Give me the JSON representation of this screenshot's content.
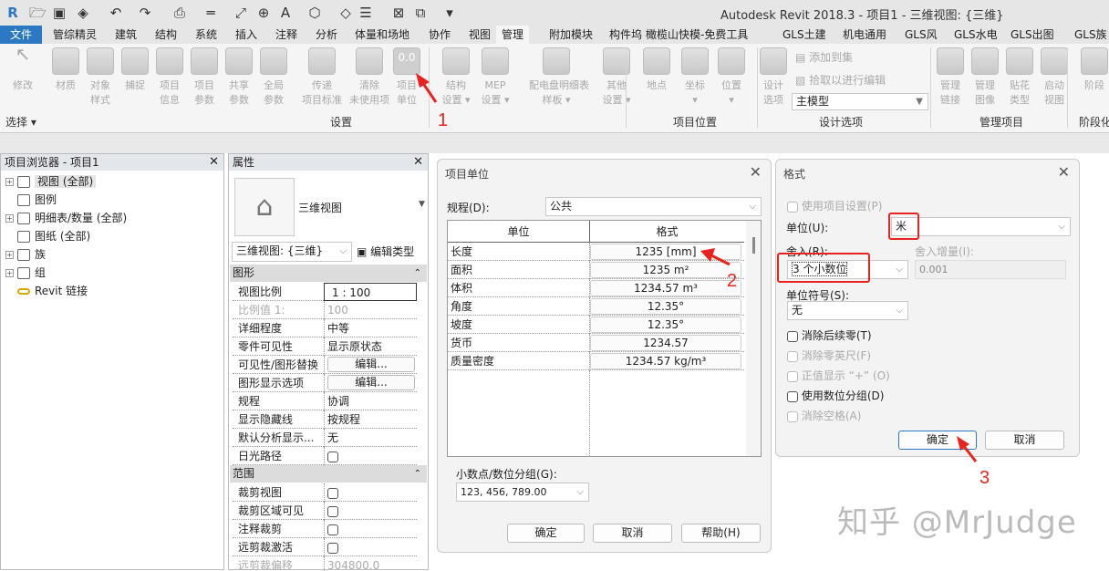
{
  "colors": {
    "accent": "#2b79c2",
    "annotation": "#e8231f",
    "watermark": "#bbbbbb"
  },
  "quick_access": [
    "revit-logo",
    "open-icon",
    "save-icon",
    "sync-icon",
    "undo-icon",
    "redo-icon",
    "print-icon",
    "measure-icon",
    "dimension-icon",
    "tag-icon",
    "text-icon",
    "3d-view-icon",
    "section-icon",
    "thin-lines-icon",
    "close-hidden-icon",
    "switch-windows-icon",
    "customize-icon"
  ],
  "app_title": "Autodesk Revit 2018.3 -     项目1 - 三维视图: {三维}",
  "tabs": [
    {
      "label": "文件"
    },
    {
      "label": "管综精灵"
    },
    {
      "label": "建筑"
    },
    {
      "label": "结构"
    },
    {
      "label": "系统"
    },
    {
      "label": "插入"
    },
    {
      "label": "注释"
    },
    {
      "label": "分析"
    },
    {
      "label": "体量和场地"
    },
    {
      "label": "协作"
    },
    {
      "label": "视图"
    },
    {
      "label": "管理"
    },
    {
      "label": "附加模块"
    },
    {
      "label": "构件坞"
    },
    {
      "label": "橄榄山快模-免费工具"
    },
    {
      "label": "GLS土建"
    },
    {
      "label": "机电通用"
    },
    {
      "label": "GLS风"
    },
    {
      "label": "GLS水电"
    },
    {
      "label": "GLS出图"
    },
    {
      "label": "GLS族"
    }
  ],
  "active_tab": "管理",
  "ribbon": {
    "buttons": [
      {
        "label": "修改",
        "icon": "cursor-icon"
      },
      {
        "label": "材质",
        "icon": "material-sphere-icon"
      },
      {
        "label": "对象\n样式",
        "icon": "object-styles-icon"
      },
      {
        "label": "捕捉",
        "icon": "snap-magnet-icon"
      },
      {
        "label": "项目\n信息",
        "icon": "project-info-icon"
      },
      {
        "label": "项目\n参数",
        "icon": "project-params-icon"
      },
      {
        "label": "共享\n参数",
        "icon": "shared-params-icon"
      },
      {
        "label": "全局\n参数",
        "icon": "global-params-icon"
      },
      {
        "label": "传递\n项目标准",
        "icon": "transfer-standards-icon"
      },
      {
        "label": "清除\n未使用项",
        "icon": "purge-icon"
      },
      {
        "label": "项目\n单位",
        "icon": "project-units-icon"
      },
      {
        "label": "结构\n设置 ▾",
        "icon": "structural-settings-icon"
      },
      {
        "label": "MEP\n设置 ▾",
        "icon": "mep-settings-icon"
      },
      {
        "label": "配电盘明细表\n样板 ▾",
        "icon": "panel-schedule-icon"
      },
      {
        "label": "其他\n设置 ▾",
        "icon": "wrench-icon"
      },
      {
        "label": "地点",
        "icon": "location-globe-icon"
      },
      {
        "label": "坐标\n▾",
        "icon": "coordinates-icon"
      },
      {
        "label": "位置\n▾",
        "icon": "position-icon"
      },
      {
        "label": "设计\n选项",
        "icon": "design-options-icon"
      },
      {
        "label": "管理\n链接",
        "icon": "manage-links-icon"
      },
      {
        "label": "管理\n图像",
        "icon": "manage-images-icon"
      },
      {
        "label": "贴花\n类型",
        "icon": "decal-types-icon"
      },
      {
        "label": "启动\n视图",
        "icon": "starting-view-icon"
      },
      {
        "label": "阶段",
        "icon": "phases-icon"
      }
    ],
    "add_to_set": "添加到集",
    "pick_to_edit": "拾取以进行编辑",
    "design_option_select": "主模型",
    "panels": [
      "选择 ▾",
      "设置",
      "项目位置",
      "设计选项",
      "管理项目",
      "阶段化"
    ]
  },
  "project_browser": {
    "title": "项目浏览器 - 项目1",
    "items": [
      {
        "label": "视图 (全部)",
        "expandable": true,
        "icon": "views-icon"
      },
      {
        "label": "图例",
        "expandable": false,
        "icon": "legend-icon"
      },
      {
        "label": "明细表/数量 (全部)",
        "expandable": true,
        "icon": "schedule-icon"
      },
      {
        "label": "图纸 (全部)",
        "expandable": false,
        "icon": "sheet-icon"
      },
      {
        "label": "族",
        "expandable": true,
        "icon": "family-icon"
      },
      {
        "label": "组",
        "expandable": true,
        "icon": "group-icon"
      },
      {
        "label": "Revit 链接",
        "expandable": false,
        "icon": "link-icon"
      }
    ]
  },
  "properties": {
    "title": "属性",
    "type_name": "三维视图",
    "instance_select": "三维视图: {三维}",
    "edit_type": "编辑类型",
    "sections": [
      {
        "name": "图形",
        "rows": [
          {
            "label": "视图比例",
            "value": "1 : 100",
            "kind": "input"
          },
          {
            "label": "比例值 1:",
            "value": "100",
            "kind": "disabled"
          },
          {
            "label": "详细程度",
            "value": "中等",
            "kind": "text"
          },
          {
            "label": "零件可见性",
            "value": "显示原状态",
            "kind": "text"
          },
          {
            "label": "可见性/图形替换",
            "value": "编辑...",
            "kind": "button"
          },
          {
            "label": "图形显示选项",
            "value": "编辑...",
            "kind": "button"
          },
          {
            "label": "规程",
            "value": "协调",
            "kind": "text"
          },
          {
            "label": "显示隐藏线",
            "value": "按规程",
            "kind": "text"
          },
          {
            "label": "默认分析显示...",
            "value": "无",
            "kind": "text"
          },
          {
            "label": "日光路径",
            "value": "",
            "kind": "checkbox"
          }
        ]
      },
      {
        "name": "范围",
        "rows": [
          {
            "label": "裁剪视图",
            "value": "",
            "kind": "checkbox"
          },
          {
            "label": "裁剪区域可见",
            "value": "",
            "kind": "checkbox"
          },
          {
            "label": "注释裁剪",
            "value": "",
            "kind": "checkbox"
          },
          {
            "label": "远剪裁激活",
            "value": "",
            "kind": "checkbox"
          },
          {
            "label": "远剪裁偏移",
            "value": "304800.0",
            "kind": "disabled"
          }
        ]
      }
    ]
  },
  "project_units": {
    "title": "项目单位",
    "discipline_label": "规程(D):",
    "discipline_value": "公共",
    "col_unit": "单位",
    "col_format": "格式",
    "rows": [
      {
        "unit": "长度",
        "format": "1235 [mm]"
      },
      {
        "unit": "面积",
        "format": "1235 m²"
      },
      {
        "unit": "体积",
        "format": "1234.57 m³"
      },
      {
        "unit": "角度",
        "format": "12.35°"
      },
      {
        "unit": "坡度",
        "format": "12.35°"
      },
      {
        "unit": "货币",
        "format": "1234.57"
      },
      {
        "unit": "质量密度",
        "format": "1234.57 kg/m³"
      }
    ],
    "decimal_label": "小数点/数位分组(G):",
    "decimal_value": "123, 456, 789.00",
    "ok": "确定",
    "cancel": "取消",
    "help": "帮助(H)"
  },
  "format_dialog": {
    "title": "格式",
    "use_project": "使用项目设置(P)",
    "unit_label": "单位(U):",
    "unit_value": "米",
    "rounding_label": "舍入(R):",
    "rounding_value": "3 个小数位",
    "increment_label": "舍入增量(I):",
    "increment_value": "0.001",
    "symbol_label": "单位符号(S):",
    "symbol_value": "无",
    "checks": [
      {
        "label": "消除后续零(T)",
        "enabled": true,
        "checked": false
      },
      {
        "label": "消除零英尺(F)",
        "enabled": false,
        "checked": false
      },
      {
        "label": "正值显示 “+” (O)",
        "enabled": false,
        "checked": false
      },
      {
        "label": "使用数位分组(D)",
        "enabled": true,
        "checked": false
      },
      {
        "label": "消除空格(A)",
        "enabled": false,
        "checked": false
      }
    ],
    "ok": "确定",
    "cancel": "取消"
  },
  "annotations": [
    "1",
    "2",
    "3"
  ],
  "watermark": "知乎 @MrJudge"
}
